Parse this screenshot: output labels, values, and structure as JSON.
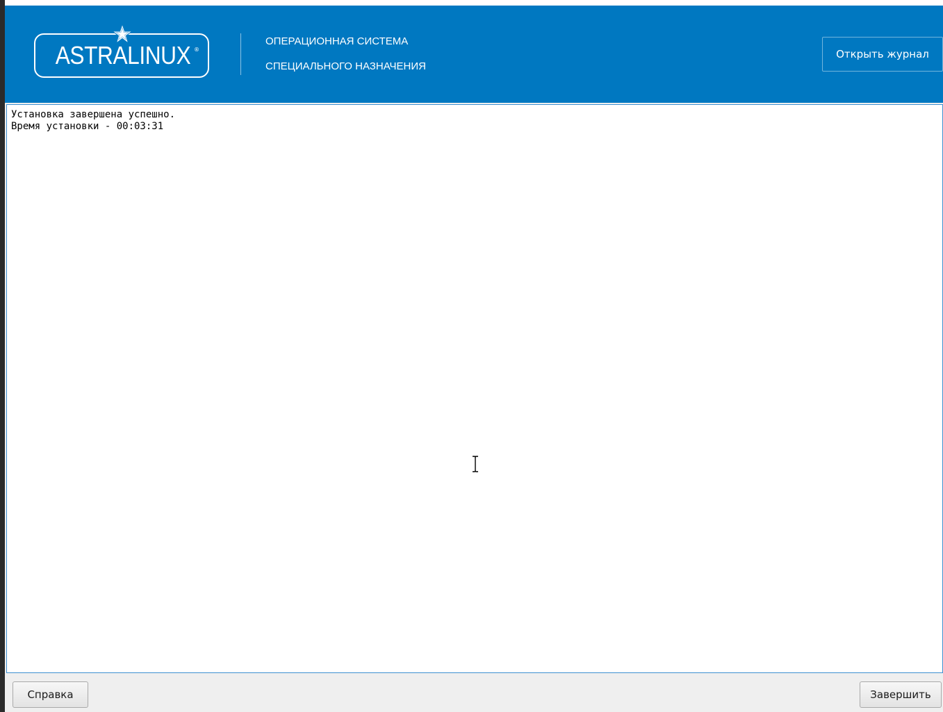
{
  "header": {
    "logo_text": "ASTRALINUX",
    "logo_mark": "®",
    "subtitle_line1": "ОПЕРАЦИОННАЯ СИСТЕМА",
    "subtitle_line2": "СПЕЦИАЛЬНОГО НАЗНАЧЕНИЯ",
    "open_log_label": "Открыть журнал"
  },
  "log": {
    "line1": "Установка завершена успешно.",
    "line2": "Время установки - 00:03:31"
  },
  "footer": {
    "help_label": "Справка",
    "finish_label": "Завершить"
  },
  "colors": {
    "header_bg": "#0078c1",
    "log_border": "#3d8fd1",
    "footer_bg": "#efefef"
  },
  "icons": {
    "logo_star": "star-icon",
    "cursor": "text-cursor-icon"
  }
}
